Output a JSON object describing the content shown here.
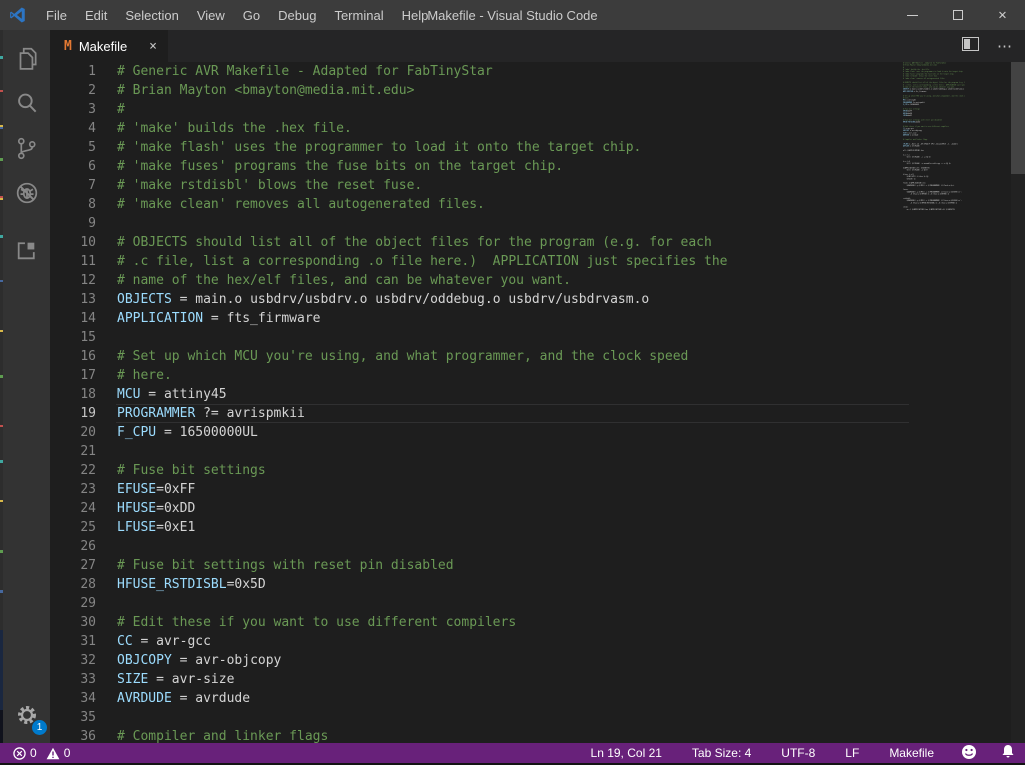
{
  "window": {
    "title": "Makefile - Visual Studio Code",
    "menus": [
      "File",
      "Edit",
      "Selection",
      "View",
      "Go",
      "Debug",
      "Terminal",
      "Help"
    ]
  },
  "tab": {
    "label": "Makefile",
    "icon_letter": "M",
    "close_glyph": "×"
  },
  "editor_actions": {
    "more_glyph": "⋯"
  },
  "activity_bar": {
    "settings_badge": "1"
  },
  "icons": [
    "vscode-logo",
    "explorer-icon",
    "search-icon",
    "source-control-icon",
    "debug-icon",
    "extensions-icon",
    "gear-icon",
    "split-editor-icon",
    "more-actions-icon",
    "error-icon",
    "warning-icon",
    "feedback-smiley-icon",
    "bell-icon",
    "minimize-icon",
    "maximize-icon",
    "close-icon"
  ],
  "colors": {
    "statusbar": "#68217A",
    "accent": "#007ACC",
    "comment": "#6A9955",
    "variable": "#9CDCFE",
    "plain": "#D4D4D4",
    "makefile_icon": "#E37933"
  },
  "editor": {
    "active_line": 19,
    "lines": [
      {
        "n": 1,
        "s": [
          [
            "# Generic AVR Makefile - Adapted for FabTinyStar",
            "c"
          ]
        ]
      },
      {
        "n": 2,
        "s": [
          [
            "# Brian Mayton <bmayton@media.mit.edu>",
            "c"
          ]
        ]
      },
      {
        "n": 3,
        "s": [
          [
            "#",
            "c"
          ]
        ]
      },
      {
        "n": 4,
        "s": [
          [
            "# 'make' builds the .hex file.",
            "c"
          ]
        ]
      },
      {
        "n": 5,
        "s": [
          [
            "# 'make flash' uses the programmer to load it onto the target chip.",
            "c"
          ]
        ]
      },
      {
        "n": 6,
        "s": [
          [
            "# 'make fuses' programs the fuse bits on the target chip.",
            "c"
          ]
        ]
      },
      {
        "n": 7,
        "s": [
          [
            "# 'make rstdisbl' blows the reset fuse.",
            "c"
          ]
        ]
      },
      {
        "n": 8,
        "s": [
          [
            "# 'make clean' removes all autogenerated files.",
            "c"
          ]
        ]
      },
      {
        "n": 9,
        "s": []
      },
      {
        "n": 10,
        "s": [
          [
            "# OBJECTS should list all of the object files for the program (e.g. for each",
            "c"
          ]
        ]
      },
      {
        "n": 11,
        "s": [
          [
            "# .c file, list a corresponding .o file here.)  APPLICATION just specifies the",
            "c"
          ]
        ]
      },
      {
        "n": 12,
        "s": [
          [
            "# name of the hex/elf files, and can be whatever you want.",
            "c"
          ]
        ]
      },
      {
        "n": 13,
        "s": [
          [
            "OBJECTS",
            "v"
          ],
          [
            " = main.o usbdrv/usbdrv.o usbdrv/oddebug.o usbdrv/usbdrvasm.o",
            "p"
          ]
        ]
      },
      {
        "n": 14,
        "s": [
          [
            "APPLICATION",
            "v"
          ],
          [
            " = fts_firmware",
            "p"
          ]
        ]
      },
      {
        "n": 15,
        "s": []
      },
      {
        "n": 16,
        "s": [
          [
            "# Set up which MCU you're using, and what programmer, and the clock speed",
            "c"
          ]
        ]
      },
      {
        "n": 17,
        "s": [
          [
            "# here.",
            "c"
          ]
        ]
      },
      {
        "n": 18,
        "s": [
          [
            "MCU",
            "v"
          ],
          [
            " = attiny45",
            "p"
          ]
        ]
      },
      {
        "n": 19,
        "s": [
          [
            "PROGRAMMER",
            "v"
          ],
          [
            " ?= avrispmkii",
            "p"
          ]
        ]
      },
      {
        "n": 20,
        "s": [
          [
            "F_CPU",
            "v"
          ],
          [
            " = 16500000UL",
            "p"
          ]
        ]
      },
      {
        "n": 21,
        "s": []
      },
      {
        "n": 22,
        "s": [
          [
            "# Fuse bit settings",
            "c"
          ]
        ]
      },
      {
        "n": 23,
        "s": [
          [
            "EFUSE",
            "v"
          ],
          [
            "=0xFF",
            "p"
          ]
        ]
      },
      {
        "n": 24,
        "s": [
          [
            "HFUSE",
            "v"
          ],
          [
            "=0xDD",
            "p"
          ]
        ]
      },
      {
        "n": 25,
        "s": [
          [
            "LFUSE",
            "v"
          ],
          [
            "=0xE1",
            "p"
          ]
        ]
      },
      {
        "n": 26,
        "s": []
      },
      {
        "n": 27,
        "s": [
          [
            "# Fuse bit settings with reset pin disabled",
            "c"
          ]
        ]
      },
      {
        "n": 28,
        "s": [
          [
            "HFUSE_RSTDISBL",
            "v"
          ],
          [
            "=0x5D",
            "p"
          ]
        ]
      },
      {
        "n": 29,
        "s": []
      },
      {
        "n": 30,
        "s": [
          [
            "# Edit these if you want to use different compilers",
            "c"
          ]
        ]
      },
      {
        "n": 31,
        "s": [
          [
            "CC",
            "v"
          ],
          [
            " = avr-gcc",
            "p"
          ]
        ]
      },
      {
        "n": 32,
        "s": [
          [
            "OBJCOPY",
            "v"
          ],
          [
            " = avr-objcopy",
            "p"
          ]
        ]
      },
      {
        "n": 33,
        "s": [
          [
            "SIZE",
            "v"
          ],
          [
            " = avr-size",
            "p"
          ]
        ]
      },
      {
        "n": 34,
        "s": [
          [
            "AVRDUDE",
            "v"
          ],
          [
            " = avrdude",
            "p"
          ]
        ]
      },
      {
        "n": 35,
        "s": []
      },
      {
        "n": 36,
        "s": [
          [
            "# Compiler and linker flags",
            "c"
          ]
        ]
      }
    ],
    "minimap_continuation": [
      "CFLAGS = -Wall -Os -DF_CPU=$(F_CPU) -mmcu=$(MCU) -I. -Iusbdrv",
      "ASFLAGS = $(CFLAGS)",
      "",
      "all: $(APPLICATION).hex",
      "",
      "%.o: %.c",
      "\t$(CC) $(CFLAGS) -c -o $@ $<",
      "",
      "%.o: %.S",
      "\t$(CC) $(CFLAGS) -x assembler-with-cpp -c -o $@ $<",
      "",
      "$(APPLICATION).elf: $(OBJECTS)",
      "\t$(CC) $(CFLAGS) -o $@ $^",
      "",
      "%.hex: %.elf",
      "\t$(OBJCOPY) -O ihex $< $@",
      "\t$(SIZE) $<",
      "",
      "flash: $(APPLICATION).hex",
      "\t$(AVRDUDE) -p $(MCU) -c $(PROGRAMMER) -U flash:w:$<:i",
      "",
      "fuses:",
      "\t$(AVRDUDE) -p $(MCU) -c $(PROGRAMMER) -U lfuse:w:$(LFUSE):m \\",
      "\t\t-U hfuse:w:$(HFUSE):m -U efuse:w:$(EFUSE):m",
      "",
      "rstdisbl:",
      "\t$(AVRDUDE) -p $(MCU) -c $(PROGRAMMER) -U lfuse:w:$(LFUSE):m \\",
      "\t\t-U hfuse:w:$(HFUSE_RSTDISBL):m -U efuse:w:$(EFUSE):m",
      "",
      "clean:",
      "\trm -f $(APPLICATION).hex $(APPLICATION).elf $(OBJECTS)"
    ]
  },
  "status_bar": {
    "errors": "0",
    "warnings": "0",
    "right_items": [
      {
        "name": "cursor-position",
        "label": "Ln 19, Col 21"
      },
      {
        "name": "indentation",
        "label": "Tab Size: 4"
      },
      {
        "name": "encoding",
        "label": "UTF-8"
      },
      {
        "name": "eol-sequence",
        "label": "LF"
      },
      {
        "name": "language-mode",
        "label": "Makefile"
      }
    ]
  }
}
